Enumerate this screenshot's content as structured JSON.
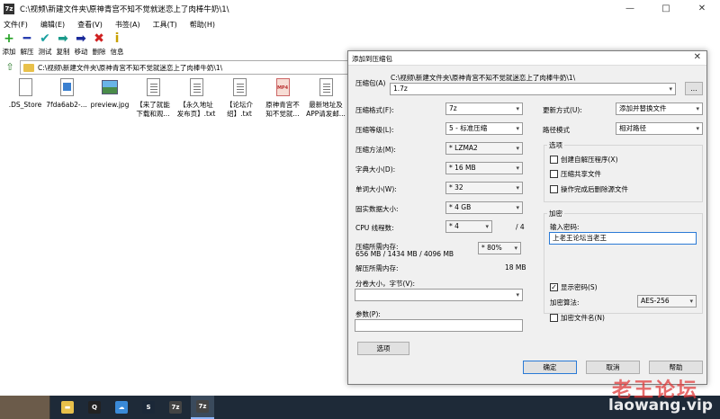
{
  "window": {
    "title": "C:\\视频\\新建文件夹\\原神青宫不知不觉就迷恋上了肉棒牛奶\\1\\",
    "app_icon": "7z",
    "minimize": "—",
    "maximize": "□",
    "close": "✕"
  },
  "menu": [
    "文件(F)",
    "编辑(E)",
    "查看(V)",
    "书签(A)",
    "工具(T)",
    "帮助(H)"
  ],
  "toolbar": [
    {
      "label": "添加",
      "icon": "plus-icon",
      "glyph": "+",
      "color": "#22a022"
    },
    {
      "label": "解压",
      "icon": "minus-icon",
      "glyph": "━",
      "color": "#2a3fb0"
    },
    {
      "label": "测试",
      "icon": "check-icon",
      "glyph": "✔",
      "color": "#1aa0a0"
    },
    {
      "label": "复制",
      "icon": "copy-arrow-icon",
      "glyph": "➡",
      "color": "#1a9a8a"
    },
    {
      "label": "移动",
      "icon": "move-arrow-icon",
      "glyph": "➡",
      "color": "#1a2a9a"
    },
    {
      "label": "删除",
      "icon": "delete-icon",
      "glyph": "✖",
      "color": "#d02020"
    },
    {
      "label": "信息",
      "icon": "info-icon",
      "glyph": "i",
      "color": "#c8a000"
    }
  ],
  "address": {
    "up_glyph": "⇧",
    "path": "C:\\视频\\新建文件夹\\原神青宫不知不觉就迷恋上了肉棒牛奶\\1\\"
  },
  "files": [
    {
      "line1": ".DS_Store",
      "line2": "",
      "kind": "doc"
    },
    {
      "line1": "7fda6ab2-...",
      "line2": "",
      "kind": "img2"
    },
    {
      "line1": "preview.jpg",
      "line2": "",
      "kind": "img"
    },
    {
      "line1": "【来了就能",
      "line2": "下载和观...",
      "kind": "txt"
    },
    {
      "line1": "【永久地址",
      "line2": "发布页】.txt",
      "kind": "txt"
    },
    {
      "line1": "【论坛介",
      "line2": "绍】.txt",
      "kind": "txt"
    },
    {
      "line1": "原神青宫不",
      "line2": "知不觉就...",
      "kind": "mp4"
    },
    {
      "line1": "最新地址及",
      "line2": "APP请发邮...",
      "kind": "txt"
    }
  ],
  "dialog": {
    "title": "添加到压缩包",
    "close": "✕",
    "archive_label": "压缩包(A)",
    "archive_path": "C:\\视频\\新建文件夹\\原神青宫不知不觉就迷恋上了肉棒牛奶\\1\\",
    "archive_name": "1.7z",
    "browse": "...",
    "left": [
      {
        "label": "压缩格式(F):",
        "value": "7z",
        "dim": false
      },
      {
        "label": "压缩等级(L):",
        "value": "5 - 标准压缩",
        "dim": false
      },
      {
        "label": "压缩方法(M):",
        "value": "* LZMA2",
        "dim": true
      },
      {
        "label": "字典大小(D):",
        "value": "* 16 MB",
        "dim": true
      },
      {
        "label": "单词大小(W):",
        "value": "* 32",
        "dim": true
      },
      {
        "label": "固实数据大小:",
        "value": "* 4 GB",
        "dim": true
      }
    ],
    "cpu": {
      "label": "CPU 线程数:",
      "value": "* 4",
      "max": "/ 4"
    },
    "mem_compress": {
      "label": "压缩所需内存:",
      "detail": "656 MB / 1434 MB / 4096 MB",
      "value": "* 80%"
    },
    "mem_decompress": {
      "label": "解压所需内存:",
      "value": "18 MB"
    },
    "split_label": "分卷大小，字节(V):",
    "params_label": "参数(P):",
    "options_button": "选项",
    "update_label": "更新方式(U):",
    "update_value": "添加并替换文件",
    "path_label": "路径模式",
    "path_value": "相对路径",
    "options_group": "选项",
    "options": [
      {
        "label": "创建自解压程序(X)",
        "checked": false
      },
      {
        "label": "压缩共享文件",
        "checked": false
      },
      {
        "label": "操作完成后删除源文件",
        "checked": false
      }
    ],
    "encrypt_group": "加密",
    "password_label": "输入密码:",
    "password_value": "上老王论坛当老王",
    "show_password": {
      "label": "显示密码(S)",
      "checked": true
    },
    "encrypt_method_label": "加密算法:",
    "encrypt_method_value": "AES-256",
    "encrypt_names": {
      "label": "加密文件名(N)",
      "checked": false
    },
    "ok": "确定",
    "cancel": "取消",
    "help": "帮助"
  },
  "taskbar": [
    {
      "icon": "folder-icon",
      "glyph": "▬",
      "color": "#e8c04a"
    },
    {
      "icon": "qq-icon",
      "glyph": "Q",
      "color": "#222"
    },
    {
      "icon": "cloud-icon",
      "glyph": "☁",
      "color": "#3a8ad8"
    },
    {
      "icon": "steam-icon",
      "glyph": "S",
      "color": "#1b2838"
    },
    {
      "icon": "sevenzip-icon",
      "glyph": "7z",
      "color": "#444"
    },
    {
      "icon": "sevenzip-active-icon",
      "glyph": "7z",
      "color": "#444"
    }
  ],
  "watermark": {
    "cn": "老王论坛",
    "url": "laowang.vip"
  }
}
